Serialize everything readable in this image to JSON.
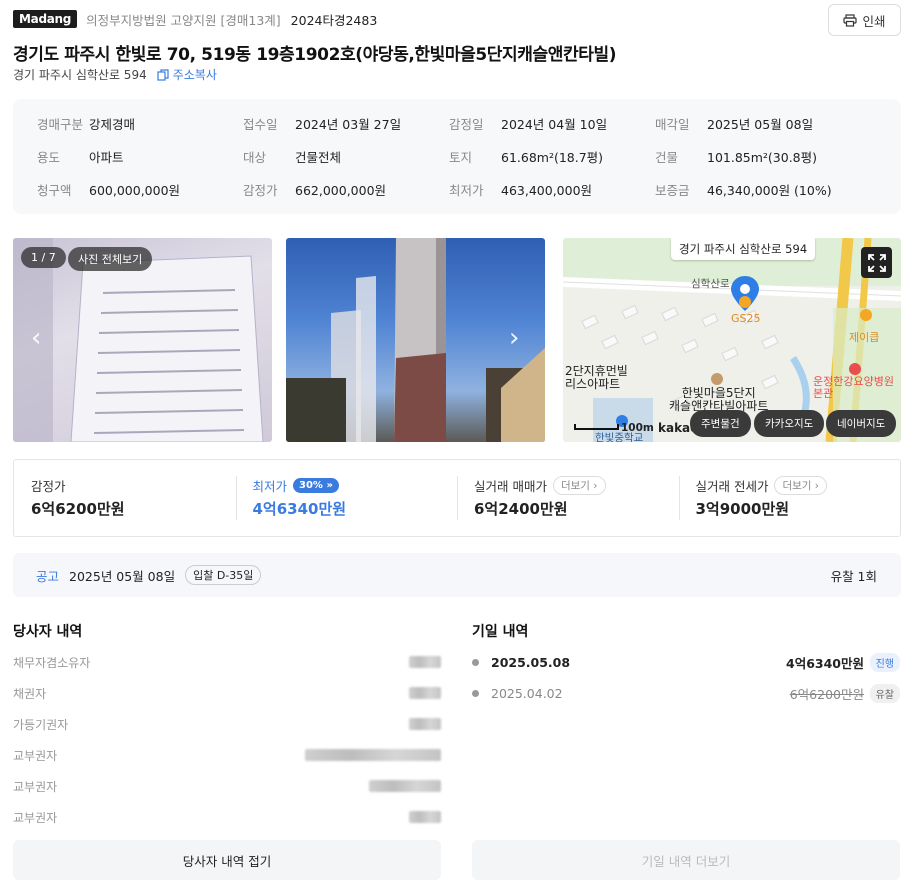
{
  "header": {
    "logo": "Madang",
    "court": "의정부지방법원 고양지원 [경매13계]",
    "case_no": "2024타경2483",
    "print_label": "인쇄"
  },
  "title": "경기도 파주시 한빛로 70, 519동 19층1902호(야당동,한빛마을5단지캐슬앤칸타빌)",
  "address": "경기 파주시 심학산로 594",
  "copy_label": "주소복사",
  "info": [
    [
      {
        "k": "경매구분",
        "v": "강제경매"
      },
      {
        "k": "접수일",
        "v": "2024년 03월 27일"
      },
      {
        "k": "감정일",
        "v": "2024년 04월 10일"
      },
      {
        "k": "매각일",
        "v": "2025년 05월 08일"
      }
    ],
    [
      {
        "k": "용도",
        "v": "아파트"
      },
      {
        "k": "대상",
        "v": "건물전체"
      },
      {
        "k": "토지",
        "v": "61.68m²(18.7평)"
      },
      {
        "k": "건물",
        "v": "101.85m²(30.8평)"
      }
    ],
    [
      {
        "k": "청구액",
        "v": "600,000,000원"
      },
      {
        "k": "감정가",
        "v": "662,000,000원"
      },
      {
        "k": "최저가",
        "v": "463,400,000원"
      },
      {
        "k": "보증금",
        "v": "46,340,000원 (10%)"
      }
    ]
  ],
  "photos": {
    "counter": "1 / 7",
    "view_all": "사진 전체보기"
  },
  "map": {
    "address_label": "경기 파주시 심학산로 594",
    "road_label": "심학산로",
    "gs_label": "GS25",
    "cafe_label": "제이큽",
    "hospital_label": "운정한강요양병원\n본관",
    "apt_label": "2단지휴먼빌\n리스아파트",
    "complex_label": "한빛마을5단지\n캐슬앤칸타빌아파트",
    "school_label": "한빛중학교",
    "scale_label": "100m",
    "brand": "kakao",
    "btn_nearby": "주변물건",
    "btn_kakao": "카카오지도",
    "btn_naver": "네이버지도"
  },
  "prices": {
    "appraisal_label": "감정가",
    "appraisal_value": "6억6200만원",
    "min_label": "최저가",
    "min_pill": "30%",
    "min_value": "4억6340만원",
    "sale_label": "실거래 매매가",
    "sale_more": "더보기",
    "sale_value": "6억2400만원",
    "lease_label": "실거래 전세가",
    "lease_more": "더보기",
    "lease_value": "3억9000만원"
  },
  "notice": {
    "label": "공고",
    "date": "2025년 05월 08일",
    "dday": "입찰 D-35일",
    "fail": "유찰 1회"
  },
  "parties": {
    "title": "당사자 내역",
    "rows": [
      "채무자겸소유자",
      "채권자",
      "가등기권자",
      "교부권자",
      "교부권자",
      "교부권자"
    ],
    "button": "당사자 내역 접기"
  },
  "history": {
    "title": "기일 내역",
    "rows": [
      {
        "date": "2025.05.08",
        "amount": "4억6340만원",
        "status": "진행"
      },
      {
        "date": "2025.04.02",
        "amount": "6억6200만원",
        "status": "유찰"
      }
    ],
    "button": "기일 내역 더보기"
  }
}
